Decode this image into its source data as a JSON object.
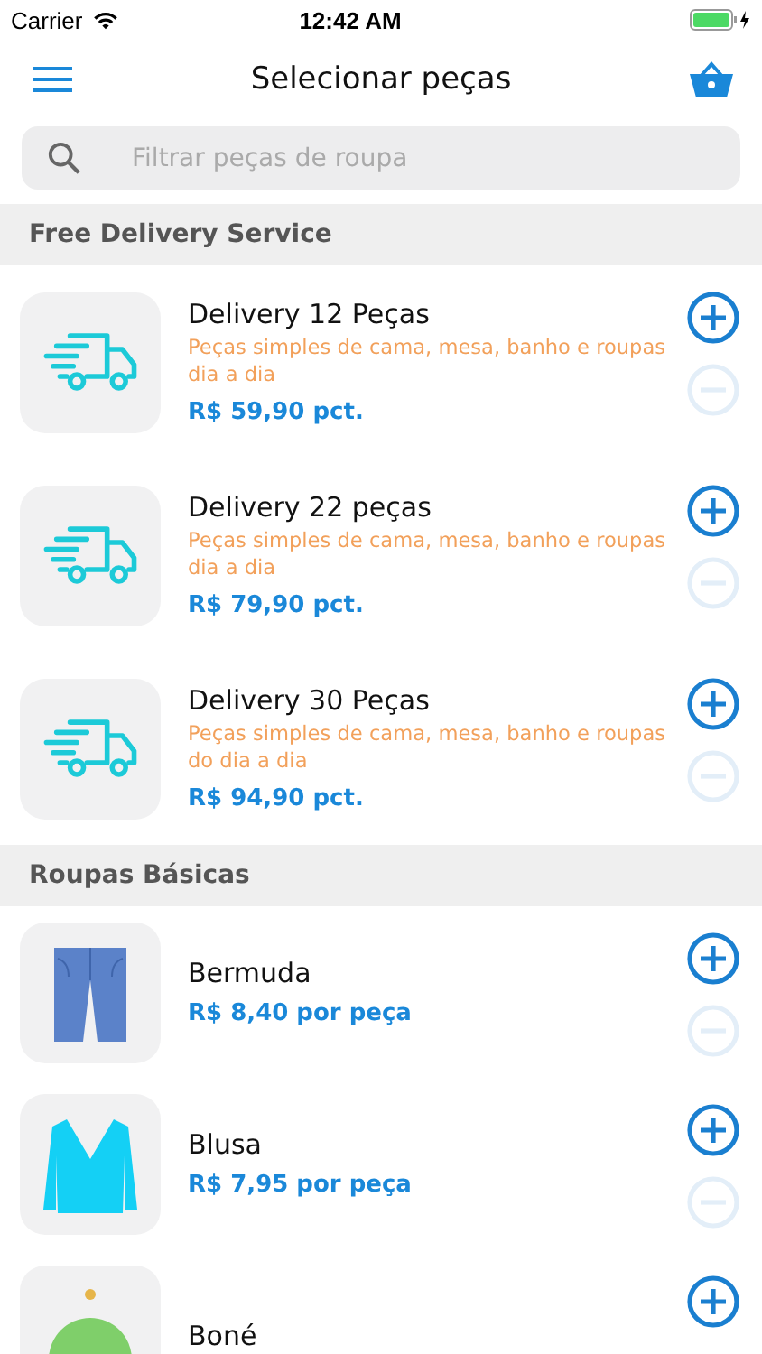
{
  "status_bar": {
    "carrier": "Carrier",
    "time": "12:42 AM"
  },
  "nav": {
    "title": "Selecionar peças"
  },
  "search": {
    "placeholder": "Filtrar peças de roupa"
  },
  "sections": [
    {
      "title": "Free Delivery Service",
      "items": [
        {
          "kind": "bundle",
          "name": "Delivery 12 Peças",
          "description": "Peças simples de cama, mesa, banho e roupas dia a dia",
          "price": "R$ 59,90 pct.",
          "minus_disabled": true
        },
        {
          "kind": "bundle",
          "name": "Delivery 22 peças",
          "description": "Peças simples de cama, mesa, banho e roupas dia a dia",
          "price": "R$ 79,90 pct.",
          "minus_disabled": true
        },
        {
          "kind": "bundle",
          "name": "Delivery 30 Peças",
          "description": "Peças simples de cama, mesa, banho e roupas do dia a dia",
          "price": "R$ 94,90 pct.",
          "minus_disabled": true
        }
      ]
    },
    {
      "title": "Roupas Básicas",
      "items": [
        {
          "kind": "shorts",
          "name": "Bermuda",
          "price": "R$ 8,40 por peça",
          "minus_disabled": true
        },
        {
          "kind": "shirt",
          "name": "Blusa",
          "price": "R$ 7,95 por peça",
          "minus_disabled": true
        },
        {
          "kind": "cap",
          "name": "Boné"
        }
      ]
    }
  ]
}
